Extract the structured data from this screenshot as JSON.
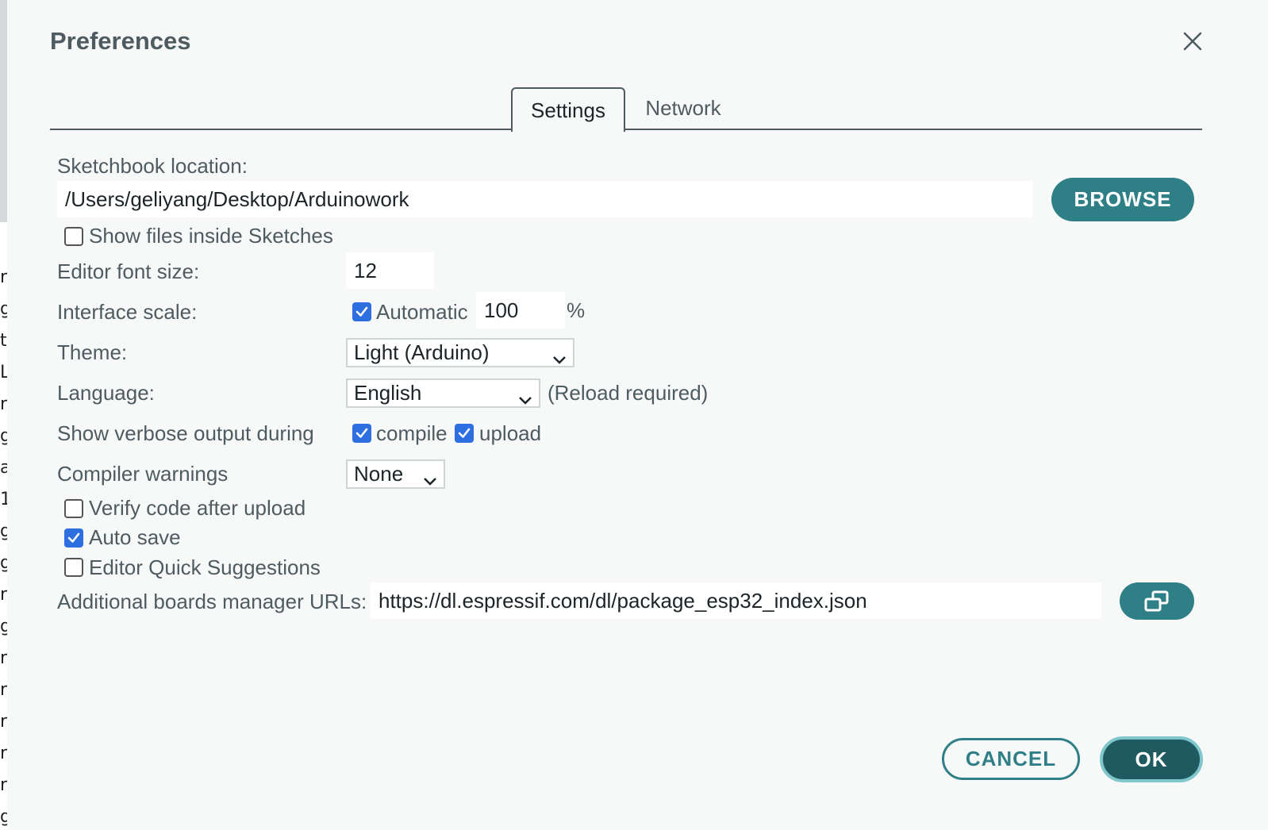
{
  "dialog": {
    "title": "Preferences",
    "tabs": [
      {
        "label": "Settings",
        "active": true
      },
      {
        "label": "Network",
        "active": false
      }
    ]
  },
  "settings": {
    "sketchbook_label": "Sketchbook location:",
    "sketchbook_value": "/Users/geliyang/Desktop/Arduinowork",
    "browse_label": "BROWSE",
    "show_files_label": "Show files inside Sketches",
    "show_files_checked": false,
    "font_size_label": "Editor font size:",
    "font_size_value": "12",
    "interface_scale_label": "Interface scale:",
    "automatic_label": "Automatic",
    "automatic_checked": true,
    "scale_value": "100",
    "scale_unit": "%",
    "theme_label": "Theme:",
    "theme_value": "Light (Arduino)",
    "language_label": "Language:",
    "language_value": "English",
    "reload_note": "(Reload required)",
    "verbose_label": "Show verbose output during",
    "compile_label": "compile",
    "compile_checked": true,
    "upload_label": "upload",
    "upload_checked": true,
    "compiler_warnings_label": "Compiler warnings",
    "compiler_warnings_value": "None",
    "verify_label": "Verify code after upload",
    "verify_checked": false,
    "autosave_label": "Auto save",
    "autosave_checked": true,
    "quick_suggestions_label": "Editor Quick Suggestions",
    "quick_suggestions_checked": false,
    "boards_urls_label": "Additional boards manager URLs:",
    "boards_urls_value": "https://dl.espressif.com/dl/package_esp32_index.json"
  },
  "footer": {
    "cancel_label": "CANCEL",
    "ok_label": "OK"
  },
  "background_chars": "r g t L r g a 1 g g r g r r r r r g c",
  "colors": {
    "accent": "#2f7f87",
    "ok_bg": "#1e5a60",
    "checkbox": "#2d6fe0",
    "text": "#4e5b61"
  }
}
